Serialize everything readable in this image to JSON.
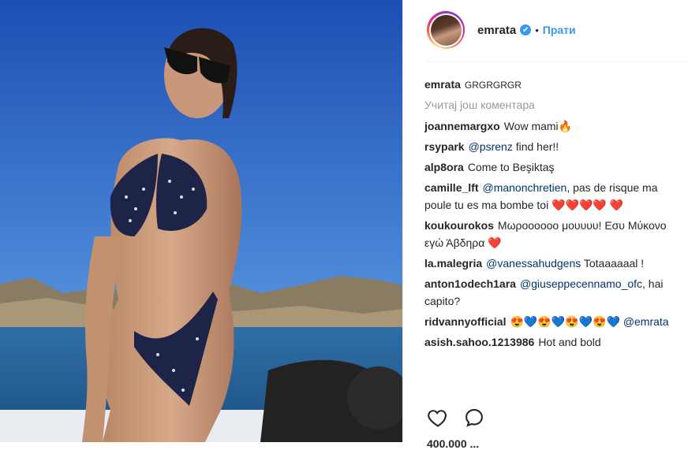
{
  "post": {
    "username": "emrata",
    "verified_mark": "✔",
    "separator": "•",
    "follow_label": "Прати",
    "caption": {
      "user": "emrata",
      "text": "GRGRGRGR"
    },
    "load_more": "Учитај још коментара",
    "likes_partial": "400.000 ..."
  },
  "comments": [
    {
      "user": "joannemargxo",
      "text": "Wow mami🔥"
    },
    {
      "user": "rsypark",
      "mention": "@psrenz",
      "text": " find her!!"
    },
    {
      "user": "alp8ora",
      "text": "Come to Beşiktaş"
    },
    {
      "user": "camille_lft",
      "mention": "@manonchretien",
      "text": ", pas de risque ma poule tu es ma bombe toi ❤️❤️❤️❤️ ❤️"
    },
    {
      "user": "koukourokos",
      "text": "Μωροοοοοο μουυυυ! Εσυ Μύκονο εγώ Άβδηρα ❤️"
    },
    {
      "user": "la.malegria",
      "mention": "@vanessahudgens",
      "text": " Totaaaaaal !"
    },
    {
      "user": "anton1odech1ara",
      "mention": "@giuseppecennamo_ofc",
      "text": ", hai capito?"
    },
    {
      "user": "ridvannyofficial",
      "text": "😍💙😍💙😍💙😍💙 ",
      "mention_after": "@emrata"
    },
    {
      "user": "asish.sahoo.1213986",
      "text": "Hot and bold"
    }
  ],
  "icons": {
    "like": "heart-outline-icon",
    "comment": "comment-bubble-icon"
  },
  "colors": {
    "accent": "#3897f0",
    "mention": "#003569",
    "muted": "#999999"
  }
}
